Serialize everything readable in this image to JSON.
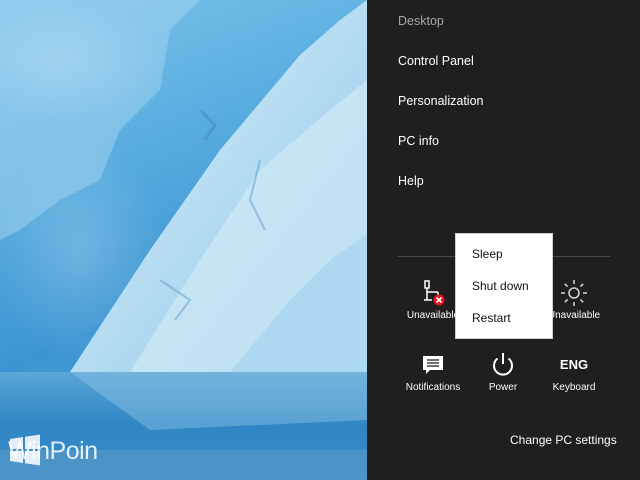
{
  "wallpaper": {
    "watermark_text": "WinPoin",
    "icon": "windows-logo-icon"
  },
  "settings_menu": {
    "items": [
      {
        "label": "Desktop",
        "state": "dimmed"
      },
      {
        "label": "Control Panel"
      },
      {
        "label": "Personalization"
      },
      {
        "label": "PC info"
      },
      {
        "label": "Help"
      }
    ]
  },
  "quick_settings": {
    "network": {
      "label": "Unavailable",
      "icon": "network-unavailable-icon"
    },
    "brightness": {
      "label": "Unavailable",
      "icon": "brightness-icon"
    },
    "notifications": {
      "label": "Notifications",
      "icon": "notifications-icon"
    },
    "power": {
      "label": "Power",
      "icon": "power-icon"
    },
    "keyboard": {
      "label": "Keyboard",
      "glyph": "ENG"
    }
  },
  "power_menu": {
    "options": [
      "Sleep",
      "Shut down",
      "Restart"
    ]
  },
  "footer": {
    "change_pc_settings": "Change PC settings"
  },
  "colors": {
    "pane_background": "#1f1f1f",
    "menu_background": "#ffffff",
    "error_badge": "#e81123"
  }
}
